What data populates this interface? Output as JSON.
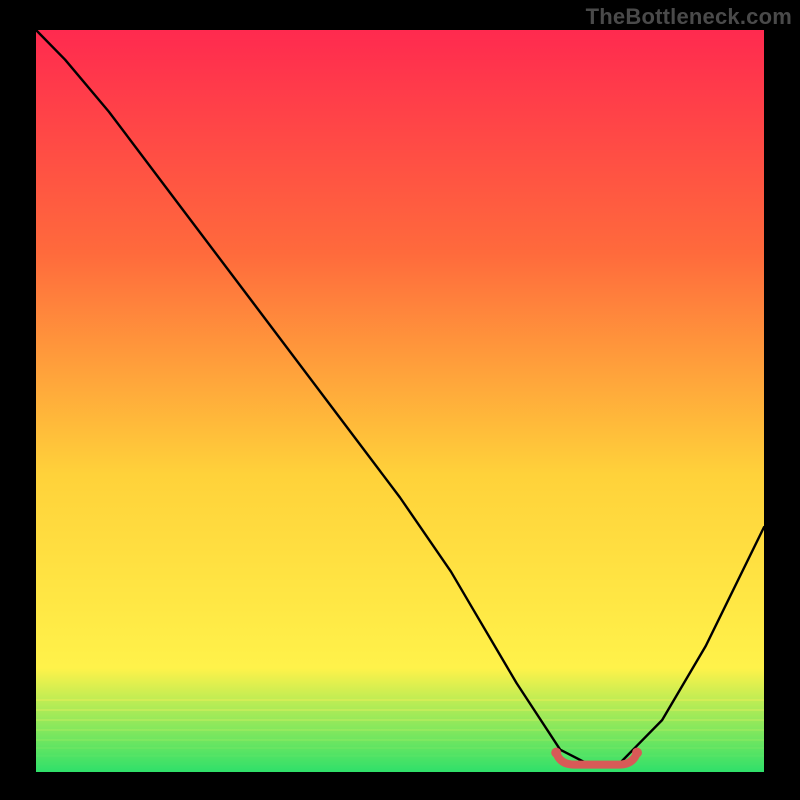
{
  "watermark": "TheBottleneck.com",
  "colors": {
    "bg_black": "#000000",
    "gradient_top": "#ff2a4f",
    "gradient_mid1": "#ff6a3c",
    "gradient_mid2": "#ffd23a",
    "gradient_mid3": "#fff24a",
    "gradient_bottom": "#2fe06a",
    "curve": "#000000",
    "marker_fill": "#d85a57",
    "marker_stroke": "#c04b49"
  },
  "chart_data": {
    "type": "line",
    "title": "",
    "xlabel": "",
    "ylabel": "",
    "x_range": [
      0,
      100
    ],
    "y_range": [
      0,
      100
    ],
    "series": [
      {
        "name": "bottleneck-curve",
        "x": [
          0,
          4,
          10,
          20,
          30,
          40,
          50,
          57,
          60,
          66,
          72,
          76,
          80,
          86,
          92,
          100
        ],
        "values": [
          100,
          96,
          89,
          76,
          63,
          50,
          37,
          27,
          22,
          12,
          3,
          1,
          1,
          7,
          17,
          33
        ]
      }
    ],
    "optimal_band": {
      "x_start": 72,
      "x_end": 82,
      "y": 1
    },
    "note": "x and y in percent of plot area; y=0 is bottom (green), y=100 is top (red). Values are visual estimates from the image."
  }
}
